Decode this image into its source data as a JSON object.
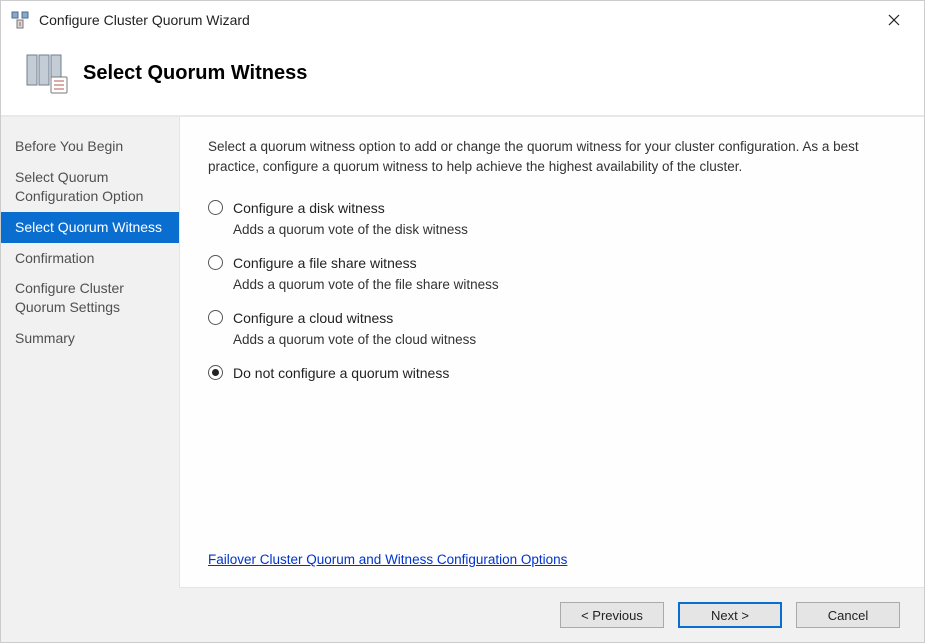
{
  "window": {
    "title": "Configure Cluster Quorum Wizard"
  },
  "header": {
    "title": "Select Quorum Witness"
  },
  "nav": {
    "items": [
      {
        "label": "Before You Begin"
      },
      {
        "label": "Select Quorum Configuration Option"
      },
      {
        "label": "Select Quorum Witness"
      },
      {
        "label": "Confirmation"
      },
      {
        "label": "Configure Cluster Quorum Settings"
      },
      {
        "label": "Summary"
      }
    ],
    "active_index": 2
  },
  "content": {
    "intro": "Select a quorum witness option to add or change the quorum witness for your cluster configuration. As a best practice, configure a quorum witness to help achieve the highest availability of the cluster.",
    "options": [
      {
        "label": "Configure a disk witness",
        "desc": "Adds a quorum vote of the disk witness",
        "checked": false
      },
      {
        "label": "Configure a file share witness",
        "desc": "Adds a quorum vote of the file share witness",
        "checked": false
      },
      {
        "label": "Configure a cloud witness",
        "desc": "Adds a quorum vote of the cloud witness",
        "checked": false
      },
      {
        "label": "Do not configure a quorum witness",
        "desc": "",
        "checked": true
      }
    ],
    "link": "Failover Cluster Quorum and Witness Configuration Options"
  },
  "footer": {
    "previous": "< Previous",
    "next": "Next >",
    "cancel": "Cancel"
  }
}
